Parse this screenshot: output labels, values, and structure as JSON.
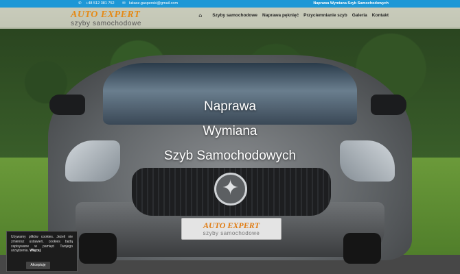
{
  "topbar": {
    "phone": "+48 512 381 752",
    "email": "lukasz.gasperski@gmail.com",
    "tagline": "Naprawa Wymiana Szyb Samochodowych"
  },
  "logo": {
    "line1": "AUTO EXPERT",
    "line2": "szyby samochodowe"
  },
  "nav": {
    "items": [
      {
        "label": "Szyby samochodowe"
      },
      {
        "label": "Naprawa pęknięć"
      },
      {
        "label": "Przyciemnianie szyb"
      },
      {
        "label": "Galeria"
      },
      {
        "label": "Kontakt"
      }
    ]
  },
  "hero": {
    "line1": "Naprawa",
    "line2": "Wymiana",
    "line3": "Szyb Samochodowych"
  },
  "plate": {
    "line1": "AUTO EXPERT",
    "line2": "szyby samochodowe"
  },
  "cookie": {
    "text": "Używamy plików cookies. Jeżeli nie zmienisz ustawień, cookies będą zapisywane w pamięci Twojego urządzenia.",
    "more": "Więcej",
    "accept": "Akceptuję"
  },
  "colors": {
    "topbar": "#1d97d6",
    "logo_orange": "#e58a16"
  }
}
